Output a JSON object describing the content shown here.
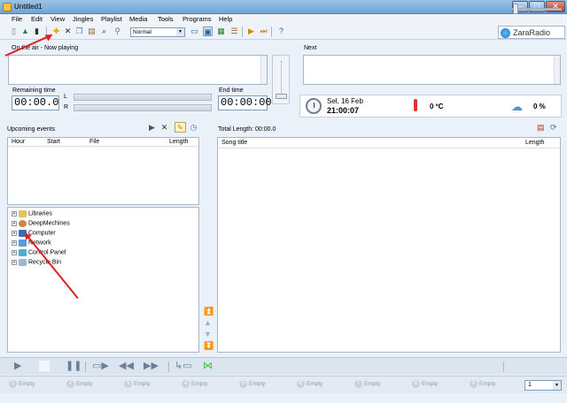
{
  "window": {
    "title": "Untitled1"
  },
  "menu": [
    "File",
    "Edit",
    "View",
    "Jingles",
    "Playlist",
    "Media",
    "Tools",
    "Programs",
    "Help"
  ],
  "toolbar": {
    "mode_value": "Normal"
  },
  "logo_text": "ZaraRadio",
  "on_air": {
    "label": "On the air - Now playing"
  },
  "next": {
    "label": "Next"
  },
  "remaining": {
    "label": "Remaining time",
    "value": "00:00.0",
    "left_channel": "L",
    "right_channel": "R"
  },
  "end_time": {
    "label": "End time",
    "value": "00:00:00"
  },
  "status": {
    "date": "Sel, 16 Feb",
    "time": "21:00:07",
    "temperature": "0 ºC",
    "humidity": "0 %"
  },
  "upcoming": {
    "label": "Upcoming events",
    "columns": [
      "Hour",
      "Start",
      "File",
      "Length"
    ]
  },
  "tree": {
    "items": [
      "Libraries",
      "DeepMechines",
      "Computer",
      "Network",
      "Control Panel",
      "Recycle Bin"
    ]
  },
  "playlist": {
    "total_length": "Total Length: 00:00.0",
    "columns": [
      "Song title",
      "Length"
    ]
  },
  "carts": [
    {
      "num": "1",
      "label": "Empty"
    },
    {
      "num": "2",
      "label": "Empty"
    },
    {
      "num": "3",
      "label": "Empty"
    },
    {
      "num": "4",
      "label": "Empty"
    },
    {
      "num": "5",
      "label": "Empty"
    },
    {
      "num": "6",
      "label": "Empty"
    },
    {
      "num": "7",
      "label": "Empty"
    },
    {
      "num": "8",
      "label": "Empty"
    },
    {
      "num": "9",
      "label": "Empty"
    }
  ],
  "cart_page": "1",
  "colors": {
    "annotation": "#e02020",
    "titlebar": "#6fa5d6"
  }
}
